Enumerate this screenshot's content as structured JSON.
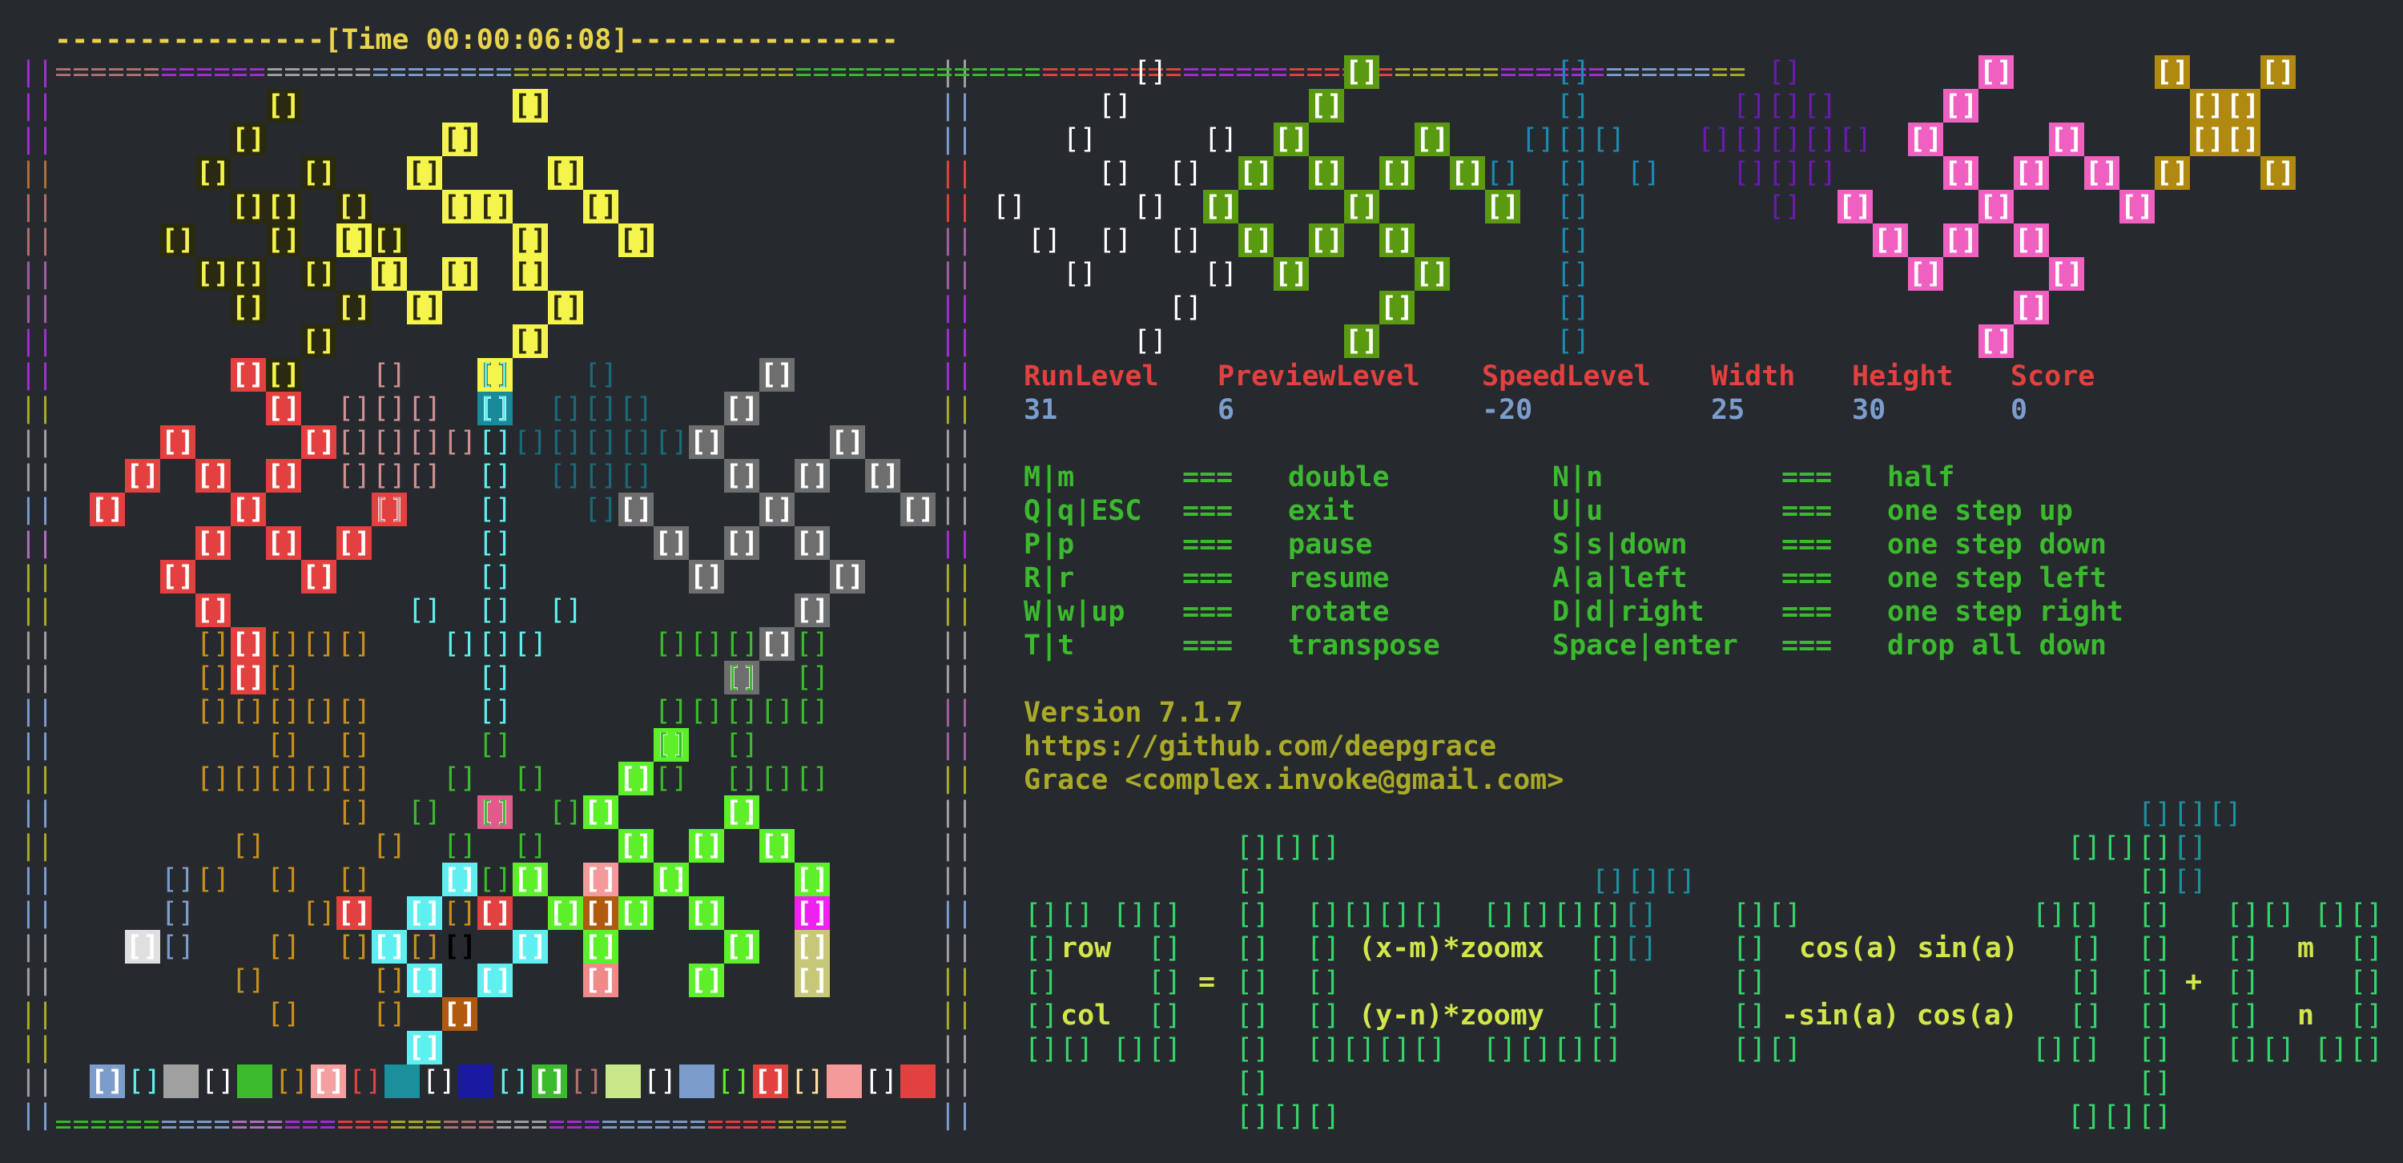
{
  "colors": {
    "background": "#262a2f",
    "timer": "#e8d34a",
    "label_red": "#e2413f",
    "value_blue": "#7c9ccc",
    "help_green": "#3cba2e",
    "info_olive": "#aaaa28",
    "matrix_green": "#35d46a",
    "matrix_teal": "#1b8f9c",
    "matrix_text": "#d2e64b"
  },
  "board": {
    "timer_line": "----------------[Time 00:00:06:08]----------------",
    "top_border": "====================================================",
    "bottom_border": "===================================================="
  },
  "stats": [
    {
      "label": "RunLevel",
      "value": "31"
    },
    {
      "label": "PreviewLevel",
      "value": "6"
    },
    {
      "label": "SpeedLevel",
      "value": "-20"
    },
    {
      "label": "Width",
      "value": "25"
    },
    {
      "label": "Height",
      "value": "30"
    },
    {
      "label": "Score",
      "value": "0"
    }
  ],
  "keys": [
    {
      "key": "M|m",
      "sep": "===",
      "action": "double",
      "key2": "N|n",
      "sep2": "===",
      "action2": "half"
    },
    {
      "key": "Q|q|ESC",
      "sep": "===",
      "action": "exit",
      "key2": "U|u",
      "sep2": "===",
      "action2": "one step up"
    },
    {
      "key": "P|p",
      "sep": "===",
      "action": "pause",
      "key2": "S|s|down",
      "sep2": "===",
      "action2": "one step down"
    },
    {
      "key": "R|r",
      "sep": "===",
      "action": "resume",
      "key2": "A|a|left",
      "sep2": "===",
      "action2": "one step left"
    },
    {
      "key": "W|w|up",
      "sep": "===",
      "action": "rotate",
      "key2": "D|d|right",
      "sep2": "===",
      "action2": "one step right"
    },
    {
      "key": "T|t",
      "sep": "===",
      "action": "transpose",
      "key2": "Space|enter",
      "sep2": "===",
      "action2": "drop all down"
    }
  ],
  "info": {
    "version": "Version 7.1.7",
    "url": "https://github.com/deepgrace",
    "author": "Grace <complex.invoke@gmail.com>"
  },
  "formula": {
    "row": "row",
    "col": "col",
    "equals": "=",
    "plus": "+",
    "xm": "(x-m)*zoomx",
    "yn": "(y-n)*zoomy",
    "cos_row": "cos(a) sin(a)",
    "sin_row": "-sin(a) cos(a)",
    "m": "m",
    "n": "n"
  }
}
